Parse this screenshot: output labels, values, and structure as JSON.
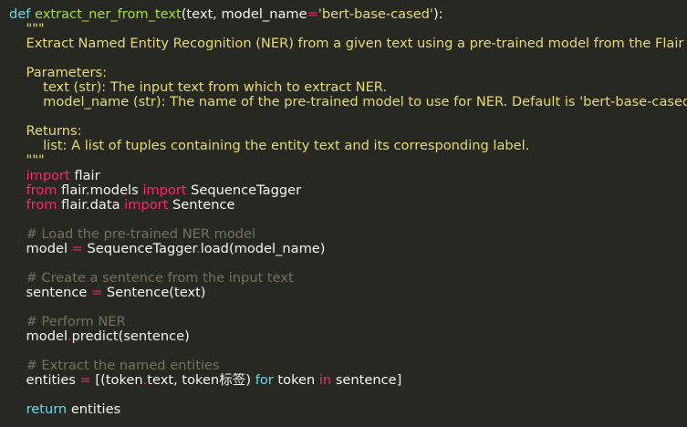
{
  "colors": {
    "background": "#272822",
    "plain": "#f8f8f2",
    "keyword": "#66d9ef",
    "function": "#a6e22e",
    "string": "#e6db74",
    "operator": "#f92672",
    "comment": "#75715e"
  },
  "code": {
    "lines": [
      [
        [
          "kw",
          "def"
        ],
        [
          "pl",
          " "
        ],
        [
          "fn",
          "extract_ner_from_text"
        ],
        [
          "pl",
          "(text, model_name"
        ],
        [
          "op",
          "="
        ],
        [
          "str",
          "'bert-base-cased'"
        ],
        [
          "pl",
          "):"
        ]
      ],
      [
        [
          "str",
          "    \"\"\""
        ]
      ],
      [
        [
          "str",
          "    Extract Named Entity Recognition (NER) from a given text using a pre-trained model from the Flair library."
        ]
      ],
      [],
      [
        [
          "str",
          "    Parameters:"
        ]
      ],
      [
        [
          "str",
          "        text (str): The input text from which to extract NER."
        ]
      ],
      [
        [
          "str",
          "        model_name (str): The name of the pre-trained model to use for NER. Default is 'bert-base-cased'."
        ]
      ],
      [],
      [
        [
          "str",
          "    Returns:"
        ]
      ],
      [
        [
          "str",
          "        list: A list of tuples containing the entity text and its corresponding label."
        ]
      ],
      [
        [
          "str",
          "    \"\"\""
        ]
      ],
      [
        [
          "pl",
          "    "
        ],
        [
          "op",
          "import"
        ],
        [
          "pl",
          " flair"
        ]
      ],
      [
        [
          "pl",
          "    "
        ],
        [
          "op",
          "from"
        ],
        [
          "pl",
          " flair.models "
        ],
        [
          "op",
          "import"
        ],
        [
          "pl",
          " SequenceTagger"
        ]
      ],
      [
        [
          "pl",
          "    "
        ],
        [
          "op",
          "from"
        ],
        [
          "pl",
          " flair.data "
        ],
        [
          "op",
          "import"
        ],
        [
          "pl",
          " Sentence"
        ]
      ],
      [],
      [
        [
          "pl",
          "    "
        ],
        [
          "cm",
          "# Load the pre-trained NER model"
        ]
      ],
      [
        [
          "pl",
          "    model "
        ],
        [
          "op",
          "="
        ],
        [
          "pl",
          " SequenceTagger"
        ],
        [
          "op",
          "."
        ],
        [
          "pl",
          "load(model_name)"
        ]
      ],
      [],
      [
        [
          "pl",
          "    "
        ],
        [
          "cm",
          "# Create a sentence from the input text"
        ]
      ],
      [
        [
          "pl",
          "    sentence "
        ],
        [
          "op",
          "="
        ],
        [
          "pl",
          " Sentence(text)"
        ]
      ],
      [],
      [
        [
          "pl",
          "    "
        ],
        [
          "cm",
          "# Perform NER"
        ]
      ],
      [
        [
          "pl",
          "    model"
        ],
        [
          "op",
          "."
        ],
        [
          "pl",
          "predict(sentence)"
        ]
      ],
      [],
      [
        [
          "pl",
          "    "
        ],
        [
          "cm",
          "# Extract the named entities"
        ]
      ],
      [
        [
          "pl",
          "    entities "
        ],
        [
          "op",
          "="
        ],
        [
          "pl",
          " [(token"
        ],
        [
          "op",
          "."
        ],
        [
          "pl",
          "text, token标签) "
        ],
        [
          "kw",
          "for"
        ],
        [
          "pl",
          " token "
        ],
        [
          "op",
          "in"
        ],
        [
          "pl",
          " sentence]"
        ]
      ],
      [],
      [
        [
          "pl",
          "    "
        ],
        [
          "kw",
          "return"
        ],
        [
          "pl",
          " entities"
        ]
      ]
    ]
  }
}
